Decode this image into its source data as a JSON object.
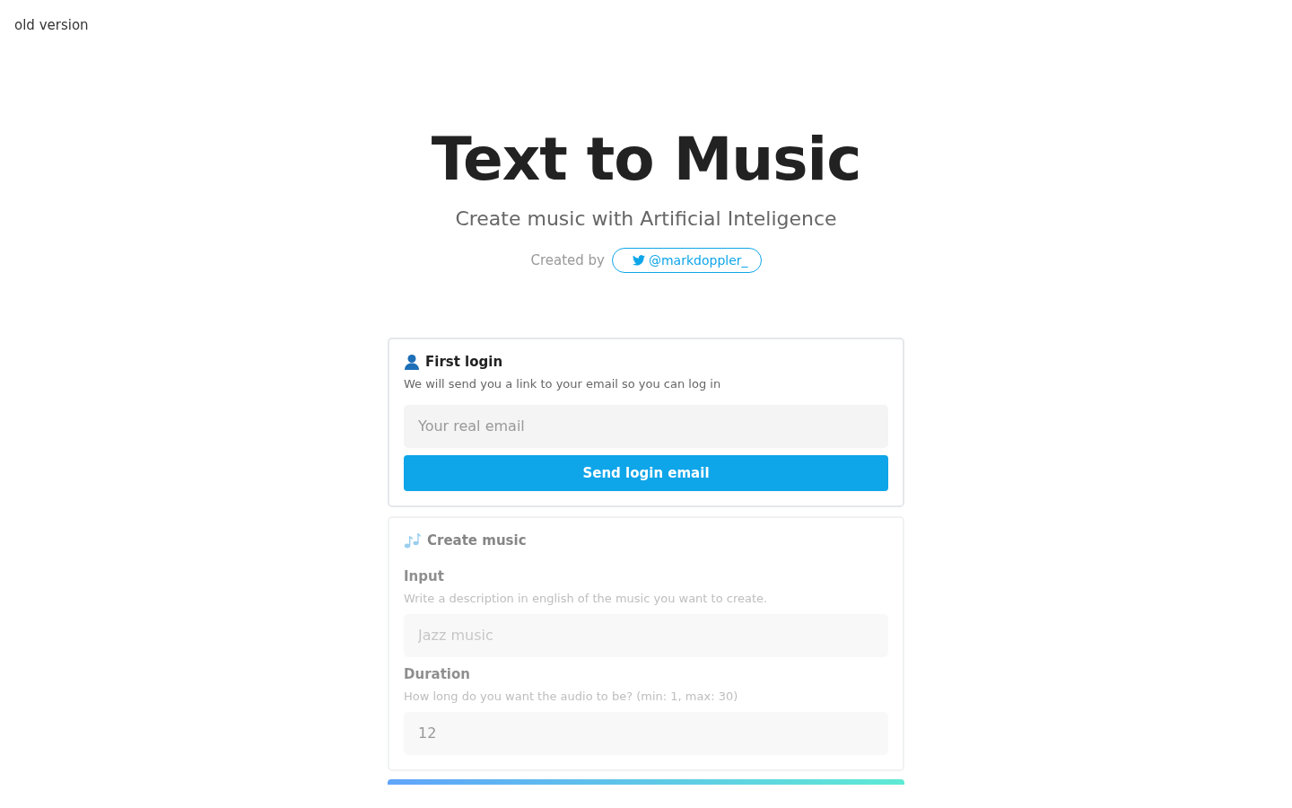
{
  "top_link": "old version",
  "title": "Text to Music",
  "subtitle": "Create music with Artificial Inteligence",
  "credit": {
    "label": "Created by",
    "handle": "@markdoppler_"
  },
  "login_card": {
    "title": "First login",
    "description": "We will send you a link to your email so you can log in",
    "email_field": {
      "placeholder": "Your real email"
    },
    "button": "Send login email"
  },
  "create_card": {
    "title": "Create music",
    "disabled": true,
    "fields": [
      {
        "label": "Input",
        "hint": "Write a description in english of the music you want to create.",
        "placeholder": "Jazz music"
      },
      {
        "label": "Duration",
        "hint": "How long do you want the audio to be? (min: 1, max: 30)",
        "value": "12"
      }
    ]
  }
}
